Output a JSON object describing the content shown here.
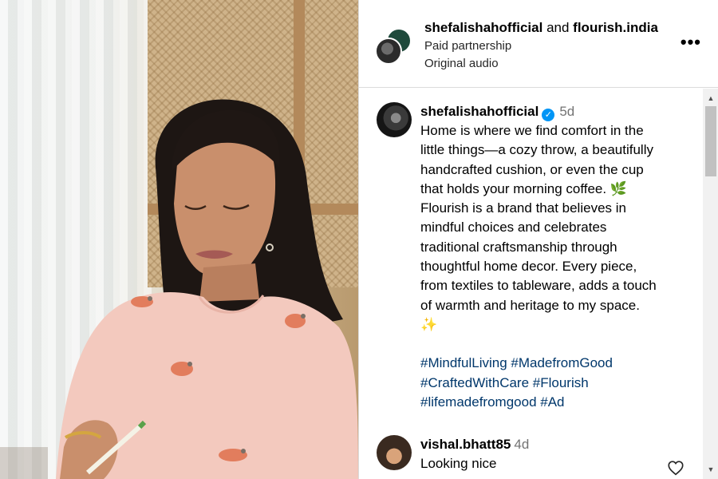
{
  "media": {
    "description_icon": "photo"
  },
  "header": {
    "author": "shefalishahofficial",
    "conjunction": "and",
    "partner": "flourish.india",
    "subtitle": "Paid partnership",
    "audio": "Original audio",
    "more_icon": "more-horizontal-icon",
    "more_label": "•••"
  },
  "caption": {
    "username": "shefalishahofficial",
    "verified_icon": "verified-badge-icon",
    "verified_glyph": "✓",
    "time": "5d",
    "lines": [
      "Home is where we find comfort in the",
      "little things—a cozy throw, a beautifully",
      "handcrafted cushion, or even the cup",
      "that holds your morning coffee. 🌿",
      "Flourish is a brand that believes in",
      "mindful choices and celebrates",
      "traditional craftsmanship through",
      "thoughtful home decor. Every piece,",
      "from textiles to tableware, adds a touch",
      "of warmth and heritage to my space.",
      "✨"
    ],
    "hashtags": [
      "#MindfulLiving #MadefromGood",
      "#CraftedWithCare #Flourish",
      "#lifemadefromgood #Ad"
    ]
  },
  "comments": [
    {
      "username": "vishal.bhatt85",
      "time": "4d",
      "text": "Looking nice",
      "like_icon": "heart-outline-icon"
    }
  ],
  "scrollbar": {
    "up_glyph": "▲",
    "down_glyph": "▼"
  }
}
